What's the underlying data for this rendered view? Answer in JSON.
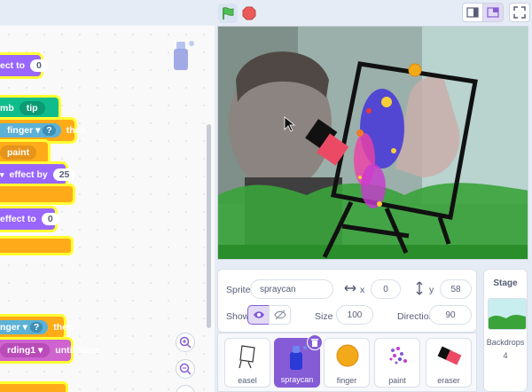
{
  "blocks": {
    "b1_label": "ect to",
    "b1_val": "0",
    "b2_mb": "mb",
    "b2_tip": "tip",
    "b3_finger": "finger",
    "b3_q": "?",
    "b3_then": "then",
    "b4_paint": "paint",
    "b5_effect": "effect by",
    "b5_val": "25",
    "b6_effect": "effect to",
    "b6_val": "0",
    "b7_nger": "nger",
    "b7_q": "?",
    "b7_then": "then",
    "b8_rding": "rding1",
    "b8_until": "until done"
  },
  "controls": {
    "zoom_in": "+",
    "zoom_out": "−",
    "zoom_reset": "="
  },
  "sprite_info": {
    "sprite_label": "Sprite",
    "sprite_name": "spraycan",
    "x_label": "x",
    "x_value": "0",
    "y_label": "y",
    "y_value": "58",
    "show_label": "Show",
    "size_label": "Size",
    "size_value": "100",
    "direction_label": "Direction",
    "direction_value": "90"
  },
  "sprites": [
    {
      "name": "easel",
      "selected": false
    },
    {
      "name": "spraycan",
      "selected": true
    },
    {
      "name": "finger",
      "selected": false
    },
    {
      "name": "paint",
      "selected": false
    },
    {
      "name": "eraser",
      "selected": false
    }
  ],
  "stage_pane": {
    "title": "Stage",
    "backdrops_label": "Backdrops",
    "backdrops_count": "4"
  },
  "colors": {
    "accent": "#855cd6",
    "looks": "#9966ff",
    "control": "#ffab19",
    "extension": "#0fbd8c",
    "sensing": "#5cb1d6",
    "highlight": "#ffff33",
    "green_flag": "#4cbf56",
    "stop": "#ec5959"
  }
}
